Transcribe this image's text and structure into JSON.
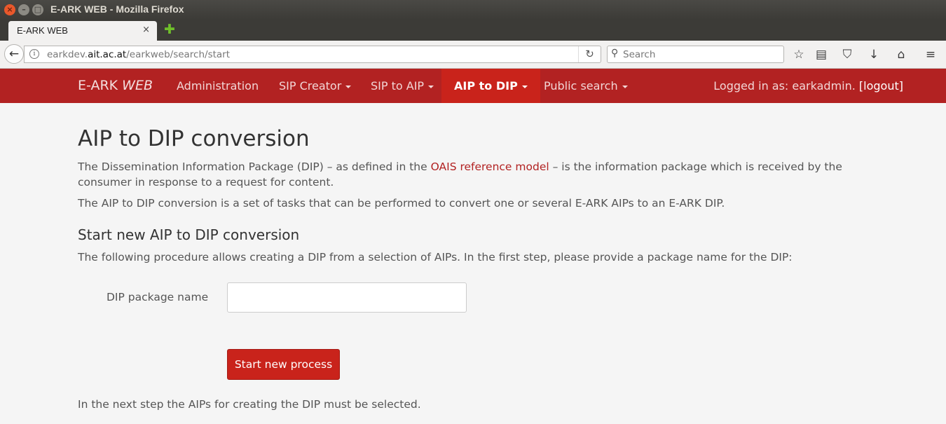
{
  "window": {
    "title": "E-ARK WEB - Mozilla Firefox",
    "close_glyph": "×",
    "minimize_glyph": "–",
    "maximize_glyph": "□"
  },
  "browser": {
    "tab_label": "E-ARK WEB",
    "tab_close_glyph": "×",
    "new_tab_glyph": "✚",
    "back_glyph": "←",
    "info_glyph": "i",
    "url_prefix": "earkdev.",
    "url_domain": "ait.ac.at",
    "url_path": "/earkweb/search/start",
    "reload_glyph": "↻",
    "search_glyph": "⚲",
    "search_placeholder": "Search",
    "toolbar_icons": {
      "bookmark_star": "☆",
      "reading_list": "▤",
      "pocket": "⛉",
      "downloads": "↓",
      "home": "⌂",
      "menu": "≡"
    }
  },
  "nav": {
    "brand_plain": "E-ARK ",
    "brand_italic": "WEB",
    "items": [
      {
        "label": "Administration",
        "has_caret": false
      },
      {
        "label": "SIP Creator",
        "has_caret": true
      },
      {
        "label": "SIP to AIP",
        "has_caret": true
      },
      {
        "label": "AIP to DIP",
        "has_caret": true,
        "active": true
      },
      {
        "label": "Public search",
        "has_caret": true
      }
    ],
    "user_prefix": "Logged in as: earkadmin. ",
    "logout_label": "[logout]"
  },
  "main": {
    "heading": "AIP to DIP conversion",
    "intro_before_link": "The Dissemination Information Package (DIP) – as defined in the ",
    "intro_link": "OAIS reference model",
    "intro_after_link": " – is the information package which is received by the consumer in response to a request for content.",
    "intro2": "The AIP to DIP conversion is a set of tasks that can be performed to convert one or several E-ARK AIPs to an E-ARK DIP.",
    "subheading": "Start new AIP to DIP conversion",
    "procedure_text": "The following procedure allows creating a DIP from a selection of AIPs. In the first step, please provide a package name for the DIP:",
    "form_label": "DIP package name",
    "form_value": "",
    "submit_label": "Start new process",
    "next_step_text": "In the next step the AIPs for creating the DIP must be selected."
  },
  "colors": {
    "navbar_bg": "#b22222",
    "active_nav_bg": "#c9231b",
    "button_bg": "#c9231b",
    "link": "#b22222"
  }
}
